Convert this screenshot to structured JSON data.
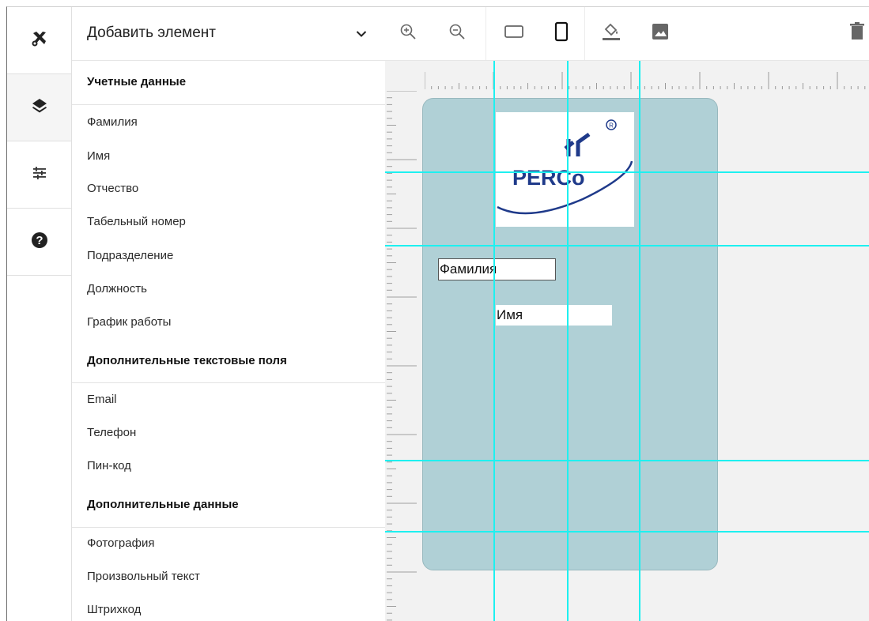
{
  "rail": {
    "items": [
      {
        "name": "tools",
        "icon": "tools-icon",
        "active": false
      },
      {
        "name": "layers",
        "icon": "layers-icon",
        "active": true
      },
      {
        "name": "settings",
        "icon": "sliders-icon",
        "active": false
      },
      {
        "name": "help",
        "icon": "help-icon",
        "active": false
      }
    ]
  },
  "panel": {
    "dropdown_label": "Добавить элемент",
    "sections": [
      {
        "title": "Учетные данные",
        "items": [
          "Фамилия",
          "Имя",
          "Отчество",
          "Табельный номер",
          "Подразделение",
          "Должность",
          "График работы"
        ]
      },
      {
        "title": "Дополнительные текстовые поля",
        "items": [
          "Email",
          "Телефон",
          "Пин-код"
        ]
      },
      {
        "title": "Дополнительные данные",
        "items": [
          "Фотография",
          "Произвольный текст",
          "Штрихкод"
        ]
      }
    ]
  },
  "toolbar": {
    "buttons": [
      "zoom-in-icon",
      "zoom-out-icon",
      "landscape-icon",
      "portrait-icon",
      "fill-color-icon",
      "image-icon",
      "delete-icon"
    ]
  },
  "canvas": {
    "logo_text": "PERCo",
    "field_1": "Фамилия",
    "field_2": "Имя"
  },
  "colors": {
    "card": "#b0d0d6",
    "guide": "#1ef0f0",
    "canvas_bg": "#f2f2f2"
  }
}
